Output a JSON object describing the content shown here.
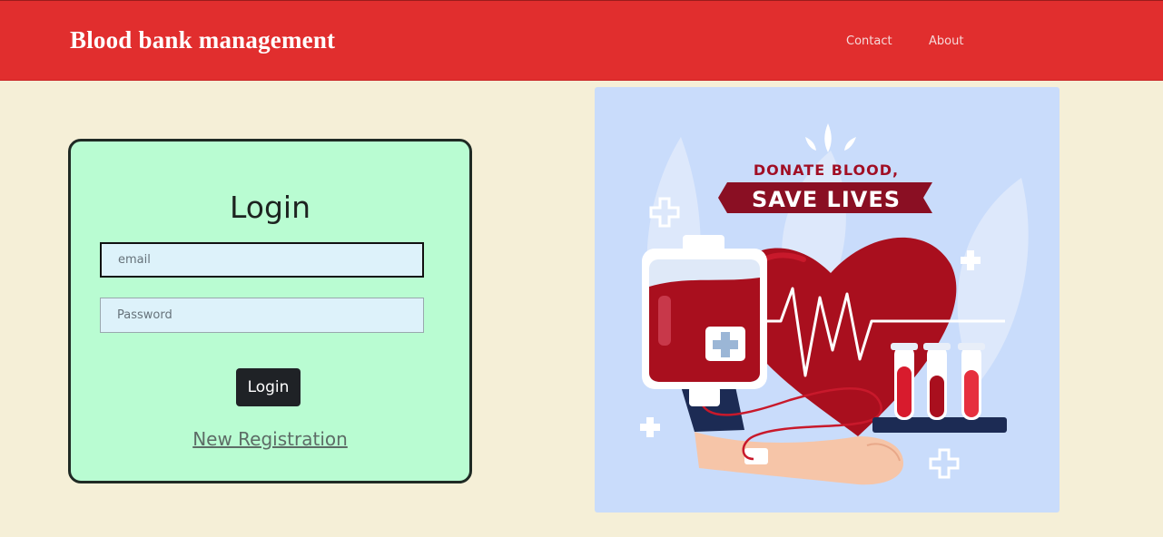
{
  "header": {
    "brand": "Blood bank management",
    "nav": {
      "contact": "Contact",
      "about": "About"
    }
  },
  "login": {
    "title": "Login",
    "email_placeholder": "email",
    "password_placeholder": "Password",
    "submit_label": "Login",
    "register_link": "New Registration"
  },
  "illustration": {
    "line1": "DONATE BLOOD,",
    "line2": "SAVE LIVES"
  },
  "colors": {
    "header_bg": "#e12e2e",
    "page_bg": "#f5efd7",
    "card_bg": "#b9fcd2",
    "illustration_bg": "#c9dcfb",
    "blood_red": "#a90f1e"
  }
}
